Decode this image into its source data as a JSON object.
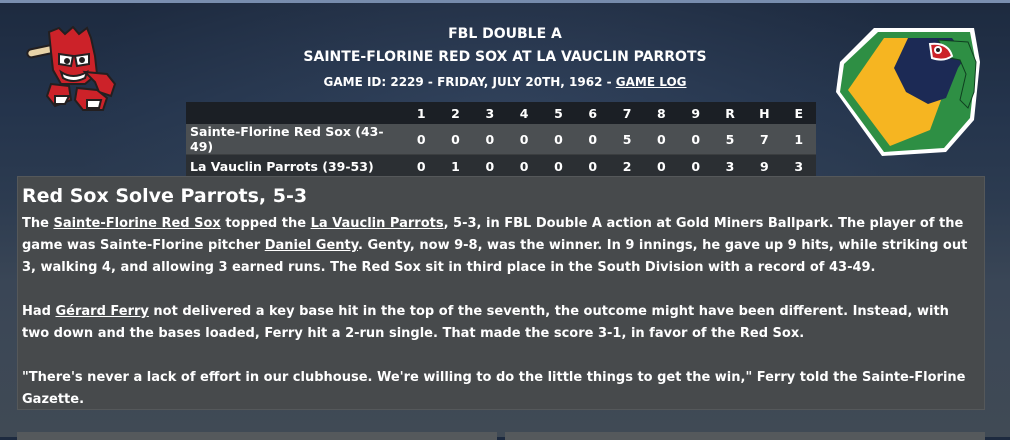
{
  "header": {
    "league": "FBL DOUBLE A",
    "matchup": "SAINTE-FLORINE RED SOX AT LA VAUCLIN PARROTS",
    "game_info": "GAME ID: 2229 - FRIDAY, JULY 20TH, 1962 - ",
    "game_log_link": "GAME LOG"
  },
  "logos": {
    "left": {
      "icon": "red-sox-mascot-logo",
      "color": "#cc2229"
    },
    "right": {
      "icon": "parrot-logo",
      "colors": [
        "#f6b521",
        "#2e8f44",
        "#1c2a55"
      ]
    }
  },
  "box_score": {
    "headers": [
      "",
      "1",
      "2",
      "3",
      "4",
      "5",
      "6",
      "7",
      "8",
      "9",
      "R",
      "H",
      "E"
    ],
    "rows": [
      {
        "team": "Sainte-Florine Red Sox (43-49)",
        "cells": [
          "0",
          "0",
          "0",
          "0",
          "0",
          "0",
          "5",
          "0",
          "0",
          "5",
          "7",
          "1"
        ]
      },
      {
        "team": "La Vauclin Parrots (39-53)",
        "cells": [
          "0",
          "1",
          "0",
          "0",
          "0",
          "0",
          "2",
          "0",
          "0",
          "3",
          "9",
          "3"
        ]
      }
    ]
  },
  "article": {
    "title": "Red Sox Solve Parrots, 5-3",
    "p1": {
      "t1": "The ",
      "link1": "Sainte-Florine Red Sox",
      "t2": " topped the ",
      "link2": "La Vauclin Parrots",
      "t3": ", 5-3, in FBL Double A action at Gold Miners Ballpark. The player of the game was Sainte-Florine pitcher ",
      "link3": "Daniel Genty",
      "t4": ". Genty, now 9-8, was the winner. In 9 innings, he gave up 9 hits, while striking out 3, walking 4, and allowing 3 earned runs. The Red Sox sit in third place in the South Division with a record of 43-49."
    },
    "p2": {
      "t1": "Had ",
      "link1": "Gérard Ferry",
      "t2": " not delivered a key base hit in the top of the seventh, the outcome might have been different. Instead, with two down and the bases loaded, Ferry hit a 2-run single. That made the score 3-1, in favor of the Red Sox."
    },
    "p3": "\"There's never a lack of effort in our clubhouse. We're willing to do the little things to get the win,\" Ferry told the Sainte-Florine Gazette."
  }
}
